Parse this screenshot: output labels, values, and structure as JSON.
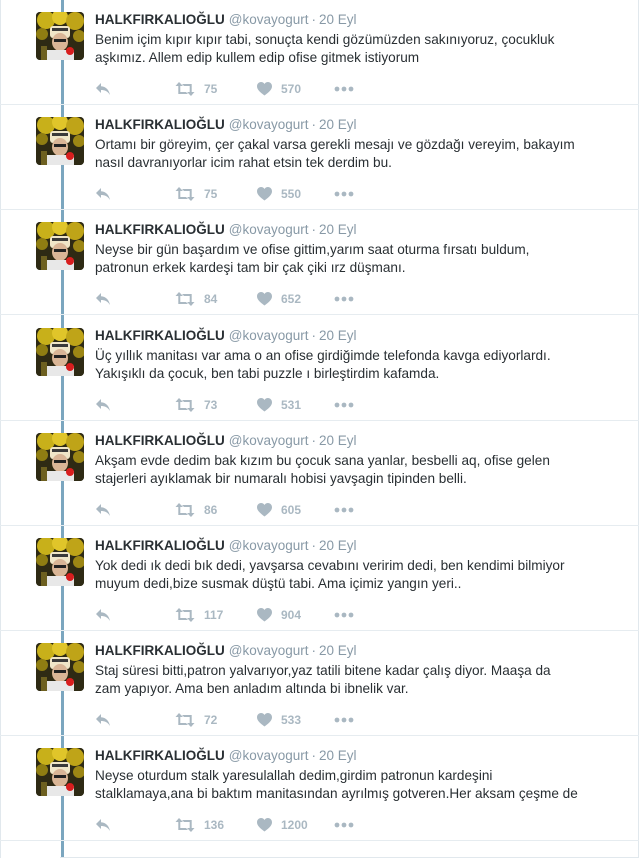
{
  "colors": {
    "thread_line": "#7ba6bf",
    "name": "#292f33",
    "meta": "#8899a6",
    "action_icon": "#aab8c2"
  },
  "icons": {
    "reply": "reply-icon",
    "retweet": "retweet-icon",
    "like": "heart-icon",
    "more": "more-icon"
  },
  "tweets": [
    {
      "name": "HALKFIRKALIOĞLU",
      "handle": "@kovayogurt",
      "dot": "·",
      "time": "20 Eyl",
      "lines": [
        "Benim içim kıpır kıpır tabi, sonuçta kendi gözümüzden sakınıyoruz, çocukluk",
        "aşkımız. Allem edip kullem edip ofise gitmek istiyorum"
      ],
      "retweets": "75",
      "likes": "570"
    },
    {
      "name": "HALKFIRKALIOĞLU",
      "handle": "@kovayogurt",
      "dot": "·",
      "time": "20 Eyl",
      "lines": [
        "Ortamı bir göreyim, çer çakal varsa gerekli mesajı ve gözdağı vereyim, bakayım",
        "nasıl davranıyorlar icim rahat etsin tek derdim bu."
      ],
      "retweets": "75",
      "likes": "550"
    },
    {
      "name": "HALKFIRKALIOĞLU",
      "handle": "@kovayogurt",
      "dot": "·",
      "time": "20 Eyl",
      "lines": [
        "Neyse bir gün başardım ve ofise gittim,yarım saat oturma fırsatı buldum,",
        "patronun erkek kardeşi tam bir çak çiki ırz düşmanı."
      ],
      "retweets": "84",
      "likes": "652"
    },
    {
      "name": "HALKFIRKALIOĞLU",
      "handle": "@kovayogurt",
      "dot": "·",
      "time": "20 Eyl",
      "lines": [
        "Üç yıllık manitası var ama o an ofise girdiğimde telefonda kavga ediyorlardı.",
        "Yakışıklı da çocuk, ben tabi puzzle ı birleştirdim kafamda."
      ],
      "retweets": "73",
      "likes": "531"
    },
    {
      "name": "HALKFIRKALIOĞLU",
      "handle": "@kovayogurt",
      "dot": "·",
      "time": "20 Eyl",
      "lines": [
        "Akşam evde dedim bak kızım bu çocuk sana yanlar, besbelli aq, ofise gelen",
        "stajerleri ayıklamak bir numaralı hobisi yavşagin tipinden belli."
      ],
      "retweets": "86",
      "likes": "605"
    },
    {
      "name": "HALKFIRKALIOĞLU",
      "handle": "@kovayogurt",
      "dot": "·",
      "time": "20 Eyl",
      "lines": [
        "Yok dedi ık dedi bık dedi, yavşarsa cevabını veririm dedi, ben kendimi bilmiyor",
        "muyum dedi,bize susmak düştü tabi. Ama içimiz yangın yeri.."
      ],
      "retweets": "117",
      "likes": "904"
    },
    {
      "name": "HALKFIRKALIOĞLU",
      "handle": "@kovayogurt",
      "dot": "·",
      "time": "20 Eyl",
      "lines": [
        "Staj süresi bitti,patron yalvarıyor,yaz tatili bitene kadar çalış diyor. Maaşa da",
        "zam yapıyor. Ama ben anladım altında bi ibnelik var."
      ],
      "retweets": "72",
      "likes": "533"
    },
    {
      "name": "HALKFIRKALIOĞLU",
      "handle": "@kovayogurt",
      "dot": "·",
      "time": "20 Eyl",
      "lines": [
        "Neyse oturdum stalk yaresulallah dedim,girdim patronun kardeşini",
        "stalklamaya,ana bi baktım manitasından ayrılmış gotveren.Her aksam çeşme de"
      ],
      "retweets": "136",
      "likes": "1200"
    }
  ]
}
